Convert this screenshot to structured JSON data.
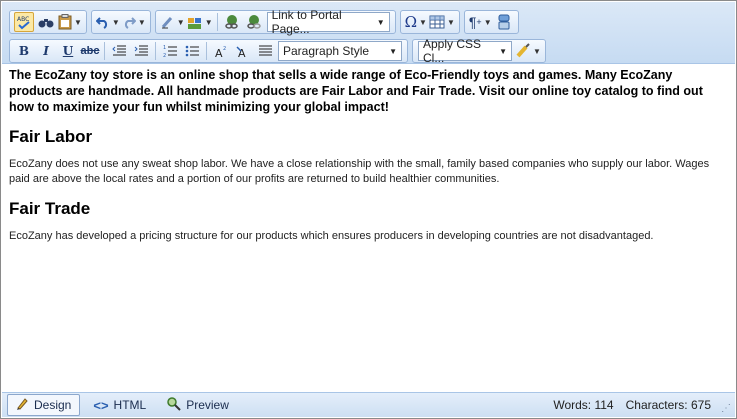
{
  "toolbar": {
    "row1": {
      "link_dropdown": "Link to Portal Page..."
    },
    "row2": {
      "bold": "B",
      "italic": "I",
      "underline": "U",
      "strike": "abc",
      "paragraph_style": "Paragraph Style",
      "css_class": "Apply CSS Cl..."
    }
  },
  "content": {
    "intro": "The EcoZany toy store is an online shop that sells a wide range of Eco-Friendly toys and games.  Many EcoZany products are handmade. All handmade products are Fair Labor and Fair Trade. Visit our online toy catalog to find out how to maximize your fun whilst minimizing your global impact!",
    "sections": [
      {
        "heading": "Fair Labor",
        "body": "EcoZany does not use any sweat shop labor. We have a close relationship with the small, family based companies who supply our labor. Wages paid are above the local rates and a portion of our profits are returned to build healthier communities."
      },
      {
        "heading": "Fair Trade",
        "body": "EcoZany has developed a pricing structure for our products which ensures producers in developing countries are not disadvantaged."
      }
    ]
  },
  "status": {
    "tabs": [
      "Design",
      "HTML",
      "Preview"
    ],
    "words": "Words: 114",
    "characters": "Characters: 675"
  },
  "icons": {
    "spellcheck": "spellcheck-icon",
    "find": "binoculars-icon",
    "paste": "clipboard-icon",
    "undo": "undo-icon",
    "redo": "redo-icon",
    "hyperlink": "hyperlink-icon",
    "table": "table-icon",
    "symbol": "omega-icon"
  }
}
